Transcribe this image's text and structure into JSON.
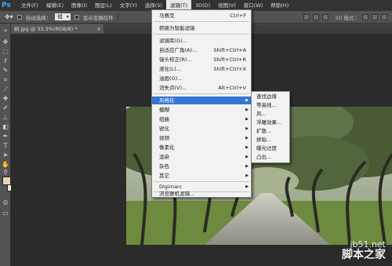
{
  "app": {
    "logo": "Ps"
  },
  "menubar": {
    "items": [
      "文件(F)",
      "编辑(E)",
      "图像(I)",
      "图层(L)",
      "文字(Y)",
      "选择(S)",
      "滤镜(T)",
      "3D(D)",
      "视图(V)",
      "窗口(W)",
      "帮助(H)"
    ],
    "active": "滤镜(T)"
  },
  "options": {
    "auto_select_label": "自动选择：",
    "auto_select_value": "组",
    "show_transform_label": "显示变换控件",
    "mode_3d_label": "3D 模式："
  },
  "document": {
    "tab_label": "树.jpg @ 33.3%(RGB/8) *",
    "close_glyph": "×"
  },
  "filter_menu": {
    "items": [
      {
        "label": "马赛克",
        "shortcut": "Ctrl+F"
      },
      {
        "label": "转换为智能滤镜",
        "shortcut": ""
      },
      {
        "label": "滤镜库(G)...",
        "shortcut": ""
      },
      {
        "label": "自适应广角(A)...",
        "shortcut": "Shift+Ctrl+A"
      },
      {
        "label": "镜头校正(R)...",
        "shortcut": "Shift+Ctrl+R"
      },
      {
        "label": "液化(L)...",
        "shortcut": "Shift+Ctrl+X"
      },
      {
        "label": "油画(O)...",
        "shortcut": ""
      },
      {
        "label": "消失点(V)...",
        "shortcut": "Alt+Ctrl+V"
      },
      {
        "label": "风格化",
        "shortcut": ""
      },
      {
        "label": "模糊",
        "shortcut": ""
      },
      {
        "label": "扭曲",
        "shortcut": ""
      },
      {
        "label": "锐化",
        "shortcut": ""
      },
      {
        "label": "视频",
        "shortcut": ""
      },
      {
        "label": "像素化",
        "shortcut": ""
      },
      {
        "label": "渲染",
        "shortcut": ""
      },
      {
        "label": "杂色",
        "shortcut": ""
      },
      {
        "label": "其它",
        "shortcut": ""
      },
      {
        "label": "Digimarc",
        "shortcut": ""
      },
      {
        "label": "浏览联机滤镜...",
        "shortcut": ""
      }
    ],
    "highlighted": "风格化"
  },
  "stylize_submenu": {
    "items": [
      "查找边缘",
      "等高线...",
      "风...",
      "浮雕效果...",
      "扩散...",
      "拼贴...",
      "曝光过度",
      "凸出..."
    ]
  },
  "watermark": {
    "url": "jb51.net",
    "name": "脚本之家"
  },
  "colors": {
    "highlight": "#3575d5",
    "menubar": "#333333",
    "toolbar": "#535353",
    "foreground_swatch": "#e9d7b1"
  }
}
